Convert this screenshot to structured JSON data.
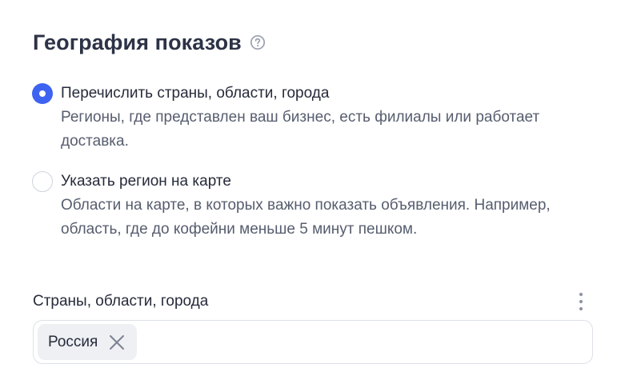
{
  "section": {
    "title": "География показов",
    "help_icon": "question-circle-icon"
  },
  "options": [
    {
      "label": "Перечислить страны, области, города",
      "description": "Регионы, где представлен ваш бизнес, есть филиалы или работает доставка.",
      "selected": true
    },
    {
      "label": "Указать регион на карте",
      "description": "Области на карте, в которых важно показать объявления. Например, область, где до кофейни меньше 5 минут пешком.",
      "selected": false
    }
  ],
  "regions_field": {
    "label": "Страны, области, города",
    "menu_icon": "kebab-menu-icon",
    "chips": [
      {
        "text": "Россия",
        "remove_icon": "close-icon"
      }
    ]
  },
  "colors": {
    "accent": "#3d63f0",
    "text_primary": "#262b3a",
    "text_secondary": "#565d6e",
    "chip_bg": "#eef0f4"
  }
}
